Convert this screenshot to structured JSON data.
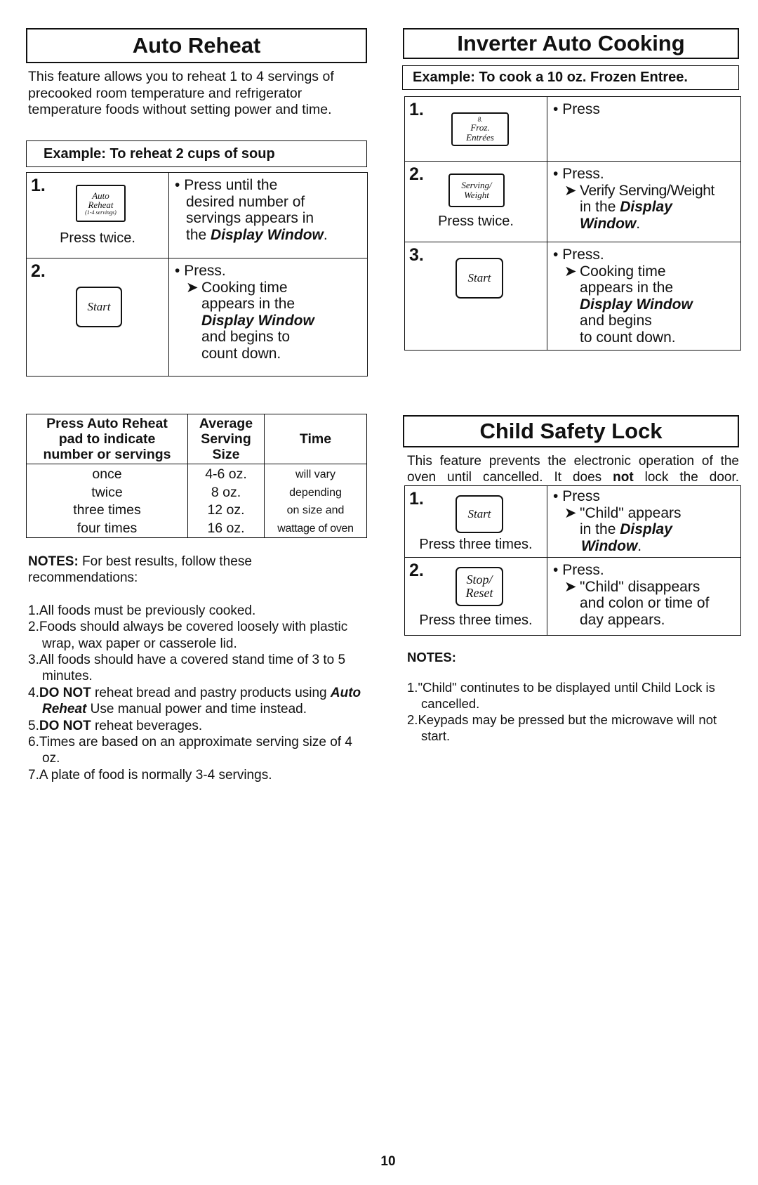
{
  "auto_reheat": {
    "title": "Auto Reheat",
    "intro": "This feature allows you to reheat 1 to 4 servings of precooked room temperature and refrigerator temperature foods without setting power and time.",
    "example": "Example:  To reheat 2 cups of soup",
    "steps": [
      {
        "number": "1.",
        "key_lines": [
          "Auto",
          "Reheat",
          "(1-4 servings)"
        ],
        "press_note": "Press twice.",
        "bullet": "•",
        "line1": "Press until the",
        "line2": "desired number of",
        "line3": "servings appears in",
        "line4_prefix": "the ",
        "line4_em": "Display Window",
        "line4_suffix": "."
      },
      {
        "number": "2.",
        "key_label": "Start",
        "bullet": "•",
        "line1": "Press.",
        "arrow": "➤",
        "sub1": "Cooking time",
        "sub2": "appears in the",
        "sub3_em": "Display Window",
        "sub4": "and begins to",
        "sub5": "count down."
      }
    ]
  },
  "inverter_auto_cooking": {
    "title": "Inverter Auto Cooking",
    "example": "Example:  To cook a 10 oz. Frozen Entree.",
    "steps": [
      {
        "number": "1.",
        "key_lines": [
          "8.",
          "Froz.",
          "Entrées"
        ],
        "bullet": "•",
        "line1": "Press"
      },
      {
        "number": "2.",
        "key_lines": [
          "Serving/",
          "Weight"
        ],
        "press_note": "Press twice.",
        "bullet": "•",
        "line1": "Press.",
        "arrow": "➤",
        "sub1": "Verify Serving/Weight",
        "sub2_prefix": "in the ",
        "sub2_em": "Display",
        "sub3_em": "Window",
        "sub3_suffix": "."
      },
      {
        "number": "3.",
        "key_label": "Start",
        "bullet": "•",
        "line1": "Press.",
        "arrow": "➤",
        "sub1": "Cooking time",
        "sub2": "appears in the",
        "sub3_em": "Display Window",
        "sub4": "and begins",
        "sub5": "to count down."
      }
    ]
  },
  "serving_table": {
    "headers": [
      "Press Auto Reheat pad to indicate number or servings",
      "Average Serving Size",
      "Time"
    ],
    "header_lines": [
      [
        "Press Auto Reheat",
        "pad to indicate",
        "number or servings"
      ],
      [
        "Average",
        "Serving",
        "Size"
      ],
      [
        "Time"
      ]
    ],
    "rows": [
      [
        "once",
        "4-6 oz.",
        "will vary"
      ],
      [
        "twice",
        "8 oz.",
        "depending"
      ],
      [
        "three times",
        "12 oz.",
        "on size and"
      ],
      [
        "four times",
        "16 oz.",
        "wattage of oven"
      ]
    ]
  },
  "reheat_notes": {
    "label": "NOTES:",
    "intro": " For best results, follow these recommendations:",
    "items": [
      {
        "num": "1.",
        "text": "All foods must be previously cooked."
      },
      {
        "num": "2.",
        "text": "Foods should always be covered loosely with plastic wrap, wax paper or casserole lid."
      },
      {
        "num": "3.",
        "text": "All foods should have a covered stand time of 3 to 5 minutes."
      },
      {
        "num": "4.",
        "bold": "DO NOT",
        "text": " reheat bread and pastry products using ",
        "em": "Auto Reheat",
        "text2": " Use manual power and time instead."
      },
      {
        "num": "5.",
        "bold": "DO NOT",
        "text": " reheat beverages."
      },
      {
        "num": "6.",
        "text": "Times are based on an approximate serving size of 4 oz."
      },
      {
        "num": "7.",
        "text": "A plate of food is normally 3-4 servings."
      }
    ]
  },
  "child_safety_lock": {
    "title": "Child Safety Lock",
    "intro_part1": "This feature prevents the electronic operation of the oven until cancelled. It does ",
    "intro_bold": "not",
    "intro_part2": " lock the door.",
    "steps": [
      {
        "number": "1.",
        "key_label": "Start",
        "press_note": "Press three times.",
        "bullet": "•",
        "line1": "Press",
        "arrow": "➤",
        "sub1": "\"Child\" appears",
        "sub2_prefix": "in the ",
        "sub2_em": "Display",
        "sub3_em": "Window",
        "sub3_suffix": "."
      },
      {
        "number": "2.",
        "key_lines": [
          "Stop/",
          "Reset"
        ],
        "press_note": "Press three times.",
        "bullet": "•",
        "line1": "Press.",
        "arrow": "➤",
        "sub1": "\"Child\" disappears",
        "sub2": "and colon or time of",
        "sub3": "day appears."
      }
    ],
    "notes_label": "NOTES:",
    "notes": [
      {
        "num": "1.",
        "text": "\"Child\" continutes to be displayed until Child Lock is cancelled."
      },
      {
        "num": "2.",
        "text": "Keypads may be pressed but the microwave will not start."
      }
    ]
  },
  "page_number": "10"
}
